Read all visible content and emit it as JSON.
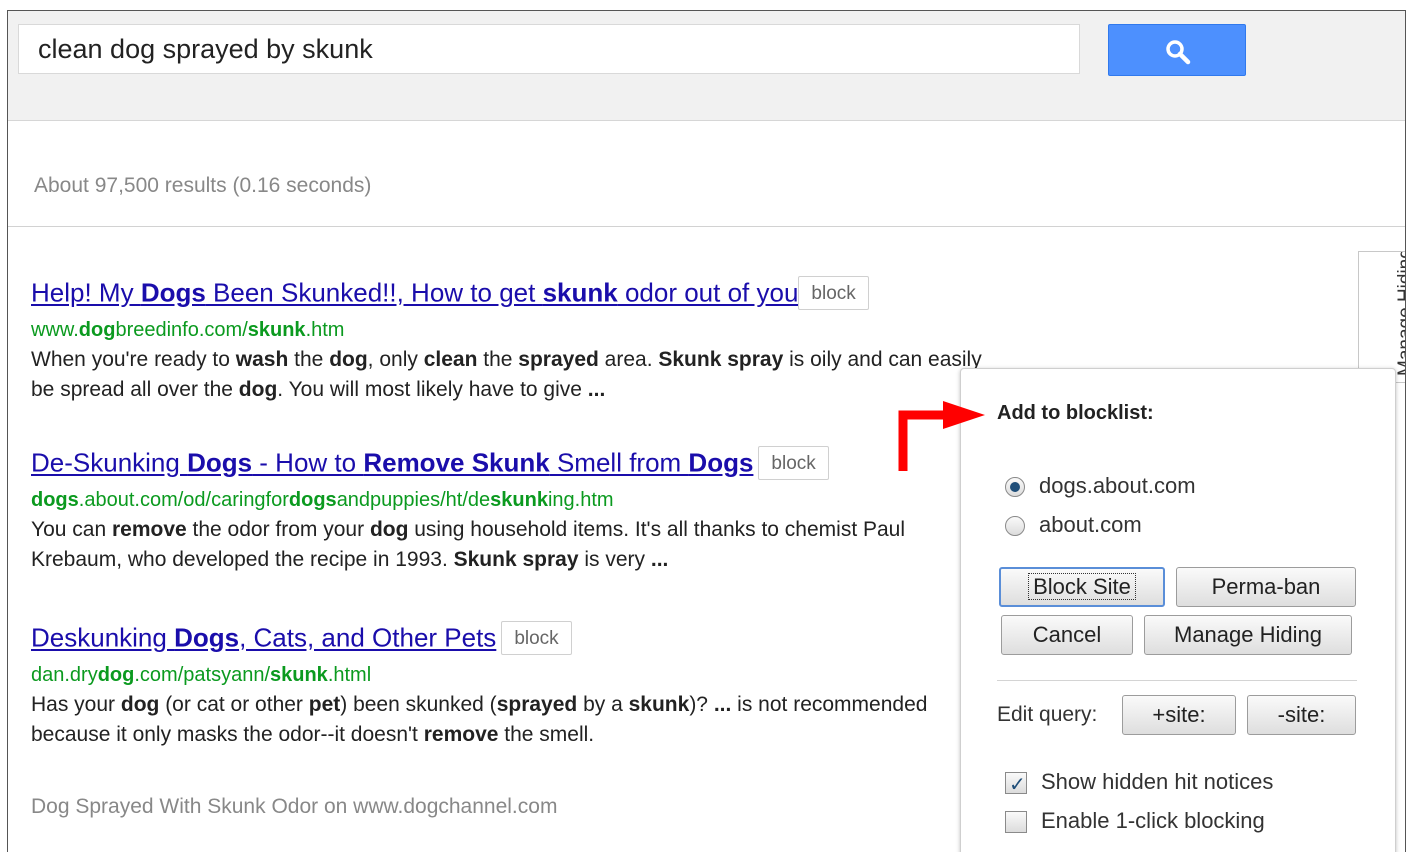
{
  "search": {
    "query": "clean dog sprayed by skunk",
    "button_icon": "search-icon"
  },
  "result_stats": "About 97,500 results (0.16 seconds)",
  "results": [
    {
      "title_html": "Help! My <b>Dogs</b> Been Skunked!!, How to get <b>skunk</b> odor out of you",
      "block_label": "block",
      "url_html": "www.<b>dog</b>breedinfo.com/<b>skunk</b>.htm",
      "snippet_html": "When you're ready to <b>wash</b> the <b>dog</b>, only <b>clean</b> the <b>sprayed</b> area. <b>Skunk spray</b> is oily and can easily be spread all over the <b>dog</b>. You will most likely have to give <b>...</b>"
    },
    {
      "title_html": "De-Skunking <b>Dogs</b> - How to <b>Remove Skunk</b> Smell from <b>Dogs</b>",
      "block_label": "block",
      "url_html": "<b>dogs</b>.about.com/od/caringfor<b>dogs</b>andpuppies/ht/de<b>skunk</b>ing.htm",
      "snippet_html": "You can <b>remove</b> the odor from your <b>dog</b> using household items. It's all thanks to chemist Paul Krebaum, who developed the recipe in 1993. <b>Skunk spray</b> is very <b>...</b>"
    },
    {
      "title_html": "Deskunking <b>Dogs</b>, Cats, and Other Pets",
      "block_label": "block",
      "url_html": "dan.dry<b>dog</b>.com/patsyann/<b>skunk</b>.html",
      "snippet_html": "Has your <b>dog</b> (or cat or other <b>pet</b>) been skunked (<b>sprayed</b> by a <b>skunk</b>)? <b>...</b> is not recommended because it only masks the odor--it doesn't <b>remove</b> the smell."
    }
  ],
  "footer_link": "Dog Sprayed With Skunk Odor on www.dogchannel.com",
  "side_tab_label": "Manage Hiding",
  "panel": {
    "title": "Add to blocklist:",
    "options": [
      {
        "label": "dogs.about.com",
        "selected": true
      },
      {
        "label": "about.com",
        "selected": false
      }
    ],
    "buttons": {
      "block_site": "Block Site",
      "perma_ban": "Perma-ban",
      "cancel": "Cancel",
      "manage_hiding": "Manage Hiding"
    },
    "edit_query_label": "Edit query:",
    "plus_site": "+site:",
    "minus_site": "-site:",
    "checkboxes": [
      {
        "label": "Show hidden hit notices",
        "checked": true
      },
      {
        "label": "Enable 1-click blocking",
        "checked": false
      }
    ]
  },
  "colors": {
    "link": "#1a0dab",
    "url_green": "#0b9a1f",
    "search_button": "#4d90fe",
    "arrow_red": "#ff0000"
  }
}
